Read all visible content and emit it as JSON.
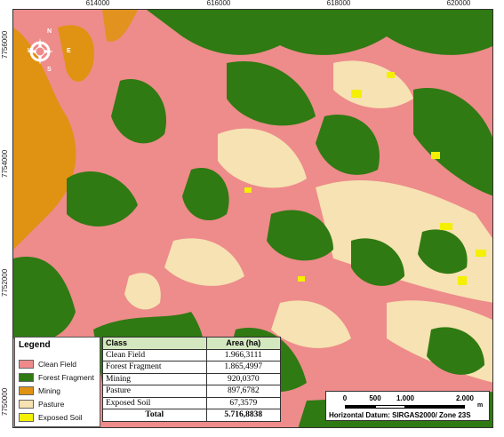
{
  "grid": {
    "eastings": [
      "614000",
      "616000",
      "618000",
      "620000"
    ],
    "northings": [
      "7756000",
      "7754000",
      "7752000",
      "7750000"
    ]
  },
  "north_arrow": {
    "n": "N",
    "s": "S",
    "e": "E",
    "w": "W"
  },
  "legend": {
    "title": "Legend",
    "items": [
      {
        "label": "Clean Field",
        "color": "#f08a8a"
      },
      {
        "label": "Forest Fragment",
        "color": "#2f7a12"
      },
      {
        "label": "Mining",
        "color": "#e09212"
      },
      {
        "label": "Pasture",
        "color": "#f6e2b2"
      },
      {
        "label": "Exposed Soil",
        "color": "#f4f000"
      }
    ]
  },
  "area_table": {
    "header": {
      "class": "Class",
      "area": "Area (ha)"
    },
    "rows": [
      {
        "class": "Clean Field",
        "area": "1.966,3111"
      },
      {
        "class": "Forest Fragment",
        "area": "1.865,4997"
      },
      {
        "class": "Mining",
        "area": "920,0370"
      },
      {
        "class": "Pasture",
        "area": "897,6782"
      },
      {
        "class": "Exposed Soil",
        "area": "67,3579"
      }
    ],
    "total": {
      "label": "Total",
      "area": "5.716,8838"
    }
  },
  "scale_bar": {
    "labels": [
      "0",
      "500",
      "1.000",
      "2.000"
    ],
    "unit": "m",
    "datum": "Horizontal Datum: SIRGAS2000/ Zone 23S"
  }
}
